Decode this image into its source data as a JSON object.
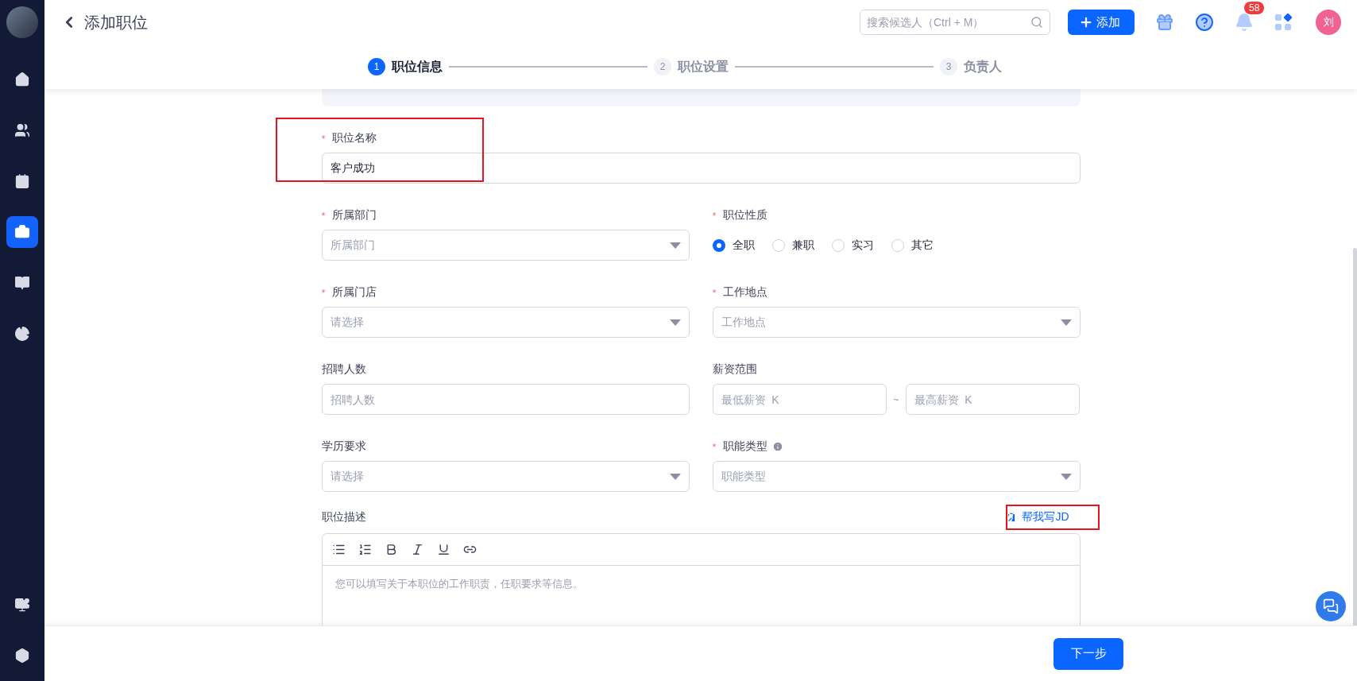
{
  "sidebar": {
    "items": [
      {
        "kind": "home",
        "selected": false
      },
      {
        "kind": "people",
        "selected": false
      },
      {
        "kind": "calendar",
        "selected": false
      },
      {
        "kind": "briefcase",
        "selected": true
      },
      {
        "kind": "book",
        "selected": false
      },
      {
        "kind": "pie",
        "selected": false
      }
    ],
    "bottom_items": [
      {
        "kind": "monitor",
        "selected": false
      },
      {
        "kind": "hexagon",
        "selected": false
      }
    ]
  },
  "header": {
    "title": "添加职位",
    "search": {
      "placeholder": "搜索候选人（Ctrl + M）"
    },
    "add_button": "添加",
    "notification_count": "58",
    "avatar": "刘"
  },
  "steps": [
    {
      "number": "1",
      "label": "职位信息",
      "selected": true
    },
    {
      "number": "2",
      "label": "职位设置",
      "selected": false
    },
    {
      "number": "3",
      "label": "负责人",
      "selected": false
    }
  ],
  "form": {
    "required_mark": "*",
    "rows": [
      {
        "fields": [
          {
            "kind": "text",
            "label": "职位名称",
            "required": true,
            "value": "客户成功",
            "highlighted": true
          }
        ]
      },
      {
        "fields": [
          {
            "kind": "select",
            "label": "所属部门",
            "required": true,
            "placeholder": "所属部门"
          },
          {
            "kind": "radio",
            "label": "职位性质",
            "required": true,
            "options": [
              {
                "label": "全职",
                "selected": true
              },
              {
                "label": "兼职",
                "selected": false
              },
              {
                "label": "实习",
                "selected": false
              },
              {
                "label": "其它",
                "selected": false
              }
            ]
          }
        ]
      },
      {
        "fields": [
          {
            "kind": "select",
            "label": "所属门店",
            "required": true,
            "placeholder": "请选择"
          },
          {
            "kind": "select",
            "label": "工作地点",
            "required": true,
            "placeholder": "工作地点"
          }
        ]
      },
      {
        "fields": [
          {
            "kind": "text",
            "label": "招聘人数",
            "required": false,
            "placeholder": "招聘人数"
          },
          {
            "kind": "range",
            "label": "薪资范围",
            "required": false,
            "min_placeholder": "最低薪资  K",
            "separator": "~",
            "max_placeholder": "最高薪资  K"
          }
        ]
      },
      {
        "fields": [
          {
            "kind": "select",
            "label": "学历要求",
            "required": false,
            "placeholder": "请选择"
          },
          {
            "kind": "select",
            "label": "职能类型",
            "required": true,
            "info": true,
            "placeholder": "职能类型"
          }
        ]
      }
    ],
    "description": {
      "label": "职位描述",
      "action": "帮我写JD",
      "action_highlighted": true,
      "placeholder": "您可以填写关于本职位的工作职责，任职要求等信息。"
    }
  },
  "footer": {
    "next_button": "下一步"
  }
}
